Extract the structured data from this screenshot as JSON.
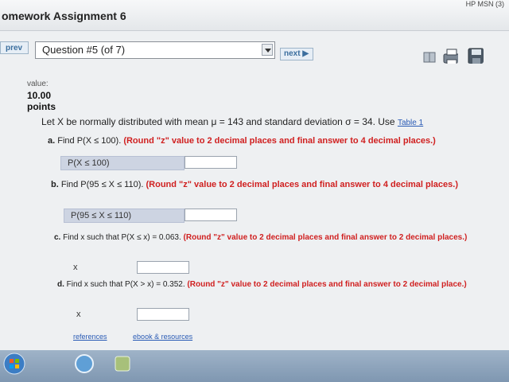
{
  "window": {
    "title": "omework Assignment 6",
    "corner_tab": "HP MSN (3)"
  },
  "nav": {
    "prev_label": "prev",
    "question_select": "Question #5 (of 7)",
    "next_label": "next ▶"
  },
  "question": {
    "value_label": "value:",
    "value_number": "10.00",
    "points_label": "points",
    "stem": "Let X be normally distributed with mean μ = 143 and standard deviation σ = 34. Use",
    "table_link": "Table 1",
    "parts": [
      {
        "letter": "a.",
        "prompt": "Find P(X ≤ 100).",
        "instruction": "(Round \"z\" value to 2 decimal places and final answer to 4 decimal places.)",
        "answer_label": "P(X ≤ 100)",
        "answer_value": ""
      },
      {
        "letter": "b.",
        "prompt": "Find P(95 ≤ X ≤ 110).",
        "instruction": "(Round \"z\" value to 2 decimal places and final answer to 4 decimal places.)",
        "answer_label": "P(95 ≤ X ≤ 110)",
        "answer_value": ""
      },
      {
        "letter": "c.",
        "prompt": "Find x such that P(X ≤ x) = 0.063.",
        "instruction": "(Round \"z\" value to 2 decimal places and final answer to 2 decimal places.)",
        "answer_label": "x",
        "answer_value": ""
      },
      {
        "letter": "d.",
        "prompt": "Find x such that P(X > x) = 0.352.",
        "instruction": "(Round \"z\" value to 2 decimal places and final answer to 2 decimal place.)",
        "answer_label": "x",
        "answer_value": ""
      }
    ]
  },
  "footer": {
    "references": "references",
    "ebook": "ebook & resources"
  },
  "icons": [
    "book-icon",
    "print-icon",
    "save-icon",
    "windows-start-icon",
    "browser-icon",
    "app-icon"
  ],
  "colors": {
    "accent_red": "#d02020",
    "link_blue": "#2a5bb5",
    "answer_label_bg": "#cdd4e2"
  }
}
